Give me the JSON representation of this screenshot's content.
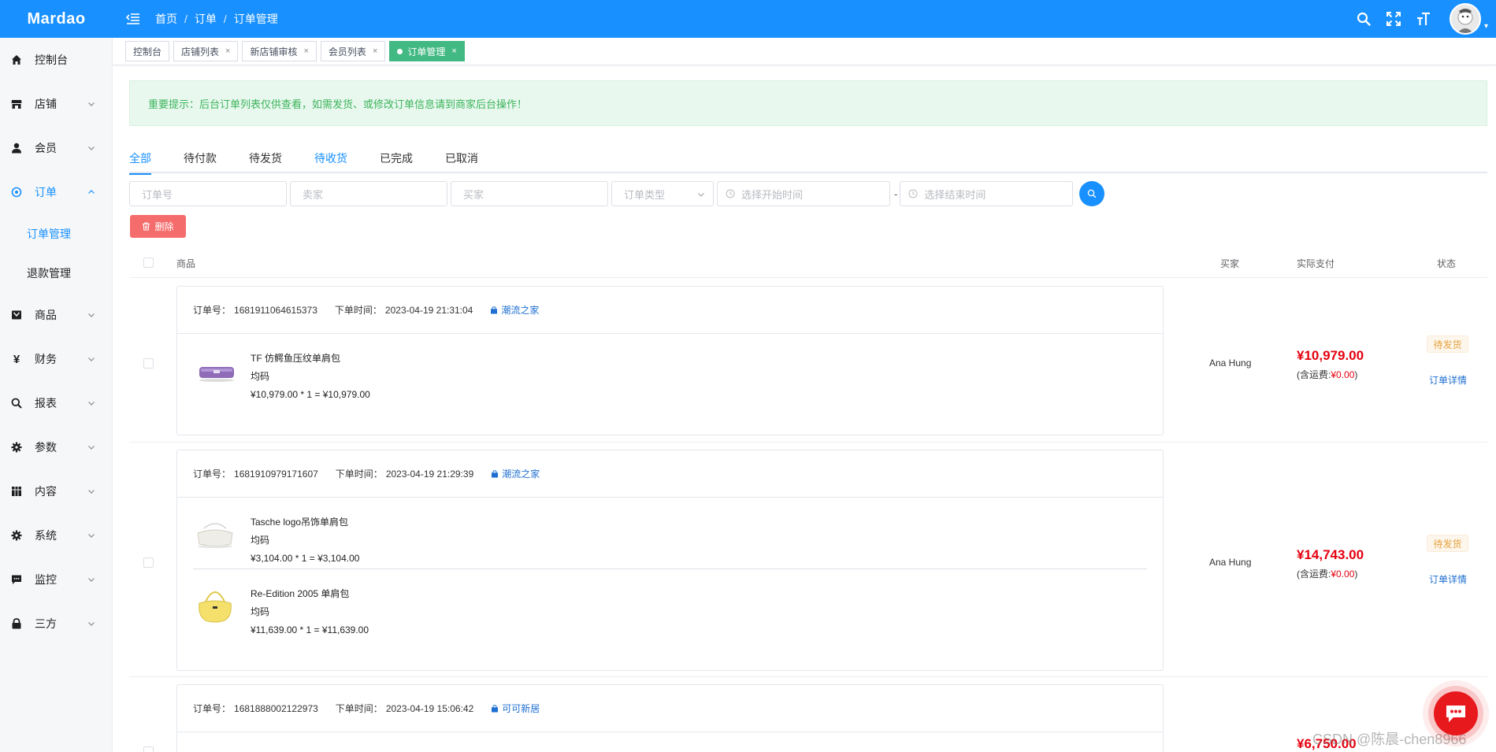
{
  "app": {
    "logo": "Mardao"
  },
  "breadcrumb": {
    "home": "首页",
    "level1": "订单",
    "current": "订单管理",
    "sep": "/"
  },
  "topbar": {
    "icons": [
      "search-icon",
      "fullscreen-icon",
      "font-size-icon",
      "user-avatar"
    ]
  },
  "sidebar": {
    "items": [
      {
        "label": "控制台",
        "icon": "home-icon"
      },
      {
        "label": "店铺",
        "icon": "store-icon"
      },
      {
        "label": "会员",
        "icon": "user-icon"
      },
      {
        "label": "订单",
        "icon": "order-icon",
        "expanded": true
      },
      {
        "label": "商品",
        "icon": "goods-icon"
      },
      {
        "label": "财务",
        "icon": "yen-icon"
      },
      {
        "label": "报表",
        "icon": "search-icon"
      },
      {
        "label": "参数",
        "icon": "gear-icon"
      },
      {
        "label": "内容",
        "icon": "grid-icon"
      },
      {
        "label": "系统",
        "icon": "gear-icon"
      },
      {
        "label": "监控",
        "icon": "chat-icon"
      },
      {
        "label": "三方",
        "icon": "lock-icon"
      }
    ],
    "order_sub": [
      {
        "label": "订单管理",
        "active": true
      },
      {
        "label": "退款管理"
      }
    ]
  },
  "tags": [
    {
      "label": "控制台",
      "closable": false
    },
    {
      "label": "店铺列表",
      "closable": true
    },
    {
      "label": "新店铺审核",
      "closable": true
    },
    {
      "label": "会员列表",
      "closable": true
    },
    {
      "label": "订单管理",
      "closable": true,
      "active": true
    }
  ],
  "tag_close": "×",
  "notice": "重要提示：后台订单列表仅供查看，如需发货、或修改订单信息请到商家后台操作！",
  "status_tabs": [
    "全部",
    "待付款",
    "待发货",
    "待收货",
    "已完成",
    "已取消"
  ],
  "filters": {
    "order_no": "订单号",
    "seller": "卖家",
    "buyer": "买家",
    "order_type": "订单类型",
    "start_time": "选择开始时间",
    "end_time": "选择结束时间",
    "range_sep": "-"
  },
  "delete_label": "删除",
  "table": {
    "col_goods": "商品",
    "col_buyer": "买家",
    "col_pay": "实际支付",
    "col_status": "状态"
  },
  "labels": {
    "order_no": "订单号：",
    "order_time": "下单时间：",
    "shipping": "(含运费:",
    "shipping_close": ")",
    "detail": "订单详情"
  },
  "orders": [
    {
      "order_no": "1681911064615373",
      "time": "2023-04-19 21:31:04",
      "shop": "潮流之家",
      "buyer": "Ana Hung",
      "amount": "¥10,979.00",
      "shipping": "¥0.00",
      "status": "待发货",
      "items": [
        {
          "name": "TF 仿鳄鱼压纹单肩包",
          "spec": "均码",
          "price_line": "¥10,979.00 * 1 = ¥10,979.00",
          "thumb": "purple-bag"
        }
      ]
    },
    {
      "order_no": "1681910979171607",
      "time": "2023-04-19 21:29:39",
      "shop": "潮流之家",
      "buyer": "Ana Hung",
      "amount": "¥14,743.00",
      "shipping": "¥0.00",
      "status": "待发货",
      "items": [
        {
          "name": "Tasche logo吊饰单肩包",
          "spec": "均码",
          "price_line": "¥3,104.00 * 1 = ¥3,104.00",
          "thumb": "white-bag"
        },
        {
          "name": "Re-Edition 2005 单肩包",
          "spec": "均码",
          "price_line": "¥11,639.00 * 1 = ¥11,639.00",
          "thumb": "yellow-bag"
        }
      ]
    },
    {
      "order_no": "1681888002122973",
      "time": "2023-04-19 15:06:42",
      "shop": "可可新居",
      "amount": "¥6,750.00"
    }
  ],
  "watermark": "CSDN @陈晨-chen8966",
  "colors": {
    "primary": "#1890ff",
    "danger": "#f56c6c",
    "price": "#e4000f",
    "tag_active": "#42b983",
    "notice_bg": "#e8f8ee",
    "warning": "#e6a23c"
  }
}
